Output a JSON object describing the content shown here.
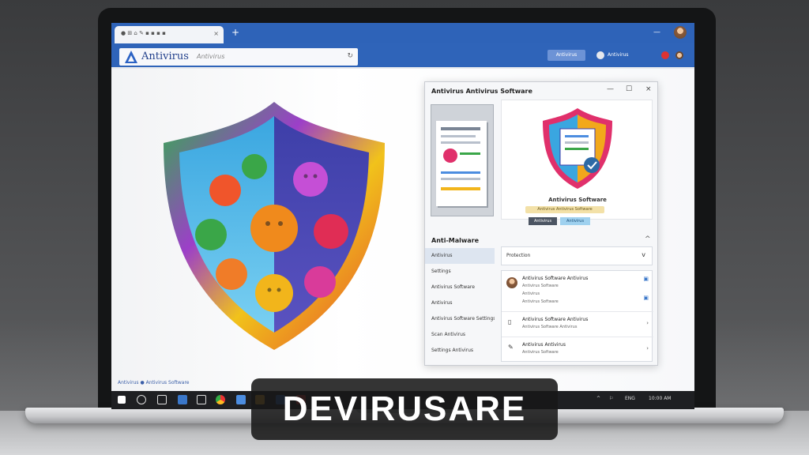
{
  "browser": {
    "tab_label": "● ⊞ ⌂ ✎ ▪ ▪ ▪ ▪",
    "tab_close": "×",
    "new_tab": "+",
    "window_controls": [
      "—",
      "☐",
      "×"
    ]
  },
  "toolbar": {
    "logo_text": "Antivirus",
    "logo_sub": "Antivirus",
    "refresh": "↻",
    "button_label": "Antivirus",
    "items": [
      "Antivirus",
      "Antivirus"
    ]
  },
  "dialog": {
    "title": "Antivirus Antivirus Software",
    "controls": [
      "—",
      "☐",
      "×"
    ],
    "preview_title": "Antivirus Software",
    "preview_banner": "Antivirus Antivirus Software",
    "preview_btn1": "Antivirus",
    "preview_btn2": "Antivirus",
    "section_title": "Anti-Malware",
    "section_chevron": "^",
    "sidebar": [
      "Antivirus",
      "Settings",
      "Antivirus Software",
      "Antivirus",
      "Antivirus Software Settings",
      "Scan Antivirus",
      "Settings Antivirus"
    ],
    "dropdown_label": "Protection",
    "dropdown_arrow": "v",
    "rows": [
      {
        "title": "Antivirus Software Antivirus",
        "sub1": "Antivirus Software",
        "sub2": "Antivirus",
        "sub3": "Antivirus Software"
      },
      {
        "title": "Antivirus Software Antivirus",
        "sub1": "Antivirus Software Antivirus"
      },
      {
        "title": "Antivirus Antivirus",
        "sub1": "Antivirus Software"
      }
    ]
  },
  "footer_note": "Antivirus ● Antivirus Software",
  "taskbar": {
    "tray_items": [
      "^",
      "⚐",
      "ENG",
      "10:00 AM"
    ]
  },
  "overlay": {
    "caption": "DEVIRUSARE"
  },
  "colors": {
    "browser_blue": "#2e63b8",
    "dialog_bg": "#f6f7f9",
    "overlay_bg": "#181818"
  }
}
